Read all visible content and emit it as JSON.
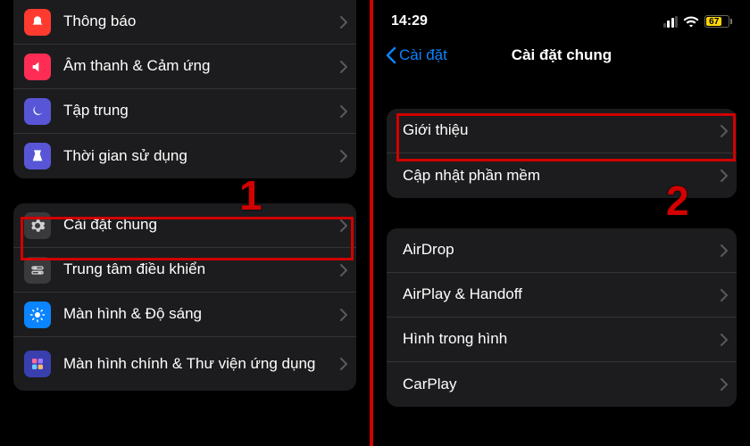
{
  "left": {
    "group1": [
      {
        "label": "Thông báo",
        "icon": "notification-icon",
        "bg": "#ff3b30"
      },
      {
        "label": "Âm thanh & Cảm ứng",
        "icon": "sound-icon",
        "bg": "#ff3b63"
      },
      {
        "label": "Tập trung",
        "icon": "focus-icon",
        "bg": "#5856d6"
      },
      {
        "label": "Thời gian sử dụng",
        "icon": "screentime-icon",
        "bg": "#5856d6"
      }
    ],
    "group2": [
      {
        "label": "Cài đặt chung",
        "icon": "gear-icon",
        "bg": "#8e8e93"
      },
      {
        "label": "Trung tâm điều khiển",
        "icon": "control-center-icon",
        "bg": "#3a3a3c"
      },
      {
        "label": "Màn hình & Độ sáng",
        "icon": "brightness-icon",
        "bg": "#0a84ff"
      },
      {
        "label": "Màn hình chính & Thư viện ứng dụng",
        "icon": "home-screen-icon",
        "bg": "#3246b7"
      }
    ]
  },
  "right": {
    "status": {
      "time": "14:29",
      "battery_pct": 67
    },
    "nav": {
      "back": "Cài đặt",
      "title": "Cài đặt chung"
    },
    "group1": [
      {
        "label": "Giới thiệu"
      },
      {
        "label": "Cập nhật phần mềm"
      }
    ],
    "group2": [
      {
        "label": "AirDrop"
      },
      {
        "label": "AirPlay & Handoff"
      },
      {
        "label": "Hình trong hình"
      },
      {
        "label": "CarPlay"
      }
    ]
  },
  "annotations": {
    "step1": "1",
    "step2": "2"
  }
}
